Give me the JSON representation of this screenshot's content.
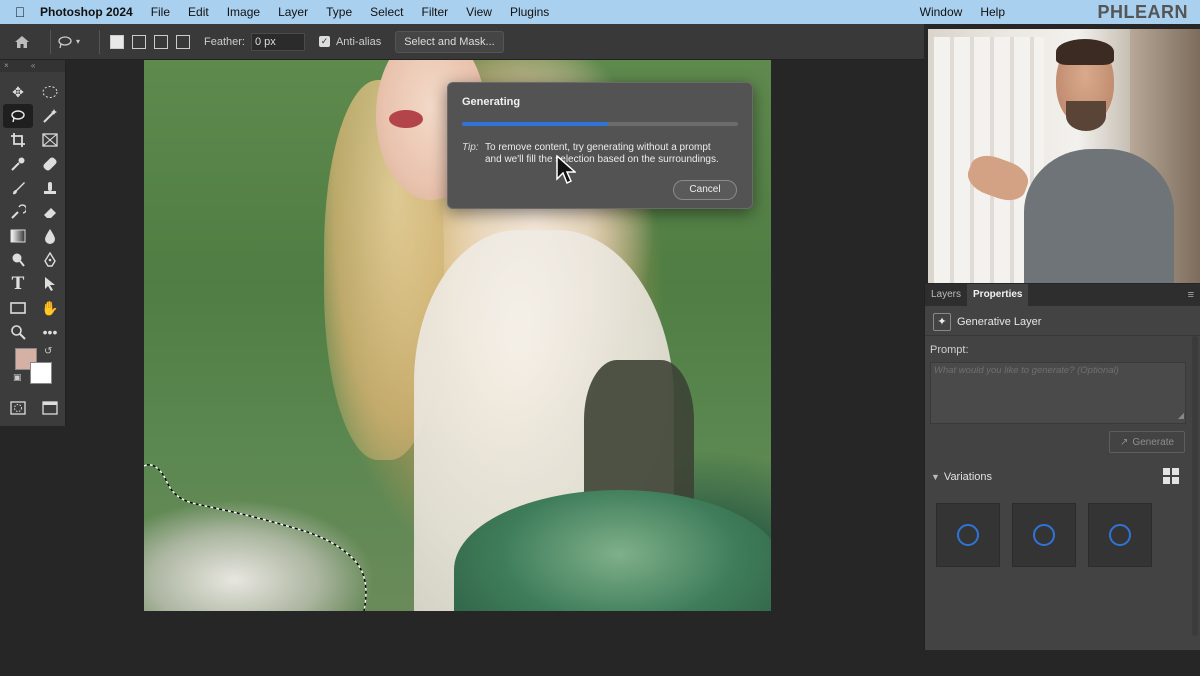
{
  "menubar": {
    "app_name": "Photoshop 2024",
    "items": [
      "File",
      "Edit",
      "Image",
      "Layer",
      "Type",
      "Select",
      "Filter",
      "View",
      "Plugins",
      "Window",
      "Help"
    ],
    "brand": "PHLEARN"
  },
  "options_bar": {
    "feather_label": "Feather:",
    "feather_value": "0 px",
    "anti_alias_label": "Anti-alias",
    "anti_alias_checked": true,
    "select_mask_label": "Select and Mask..."
  },
  "toolbar": {
    "foreground_color": "#d4b1a4",
    "background_color": "#ffffff",
    "tools": [
      "move-icon",
      "marquee-icon",
      "lasso-icon",
      "magic-wand-icon",
      "crop-icon",
      "frame-icon",
      "eyedropper-icon",
      "healing-icon",
      "brush-icon",
      "stamp-icon",
      "history-brush-icon",
      "eraser-icon",
      "gradient-icon",
      "blur-icon",
      "dodge-icon",
      "pen-icon",
      "type-icon",
      "path-select-icon",
      "rectangle-icon",
      "hand-icon",
      "zoom-icon",
      "more-icon"
    ],
    "active_tool": "lasso-icon"
  },
  "dialog": {
    "title": "Generating",
    "progress": 0.53,
    "tip_label": "Tip:",
    "tip_text": "To remove content, try generating without a prompt and we'll fill the selection based on the surroundings.",
    "cancel_label": "Cancel"
  },
  "panel": {
    "tabs": [
      "Layers",
      "Properties"
    ],
    "active_tab": "Properties",
    "layer_type": "Generative Layer",
    "prompt_label": "Prompt:",
    "prompt_placeholder": "What would you like to generate? (Optional)",
    "generate_label": "Generate",
    "variations_label": "Variations",
    "variation_count": 3
  },
  "colors": {
    "accent": "#2f74d8",
    "menubar": "#a9d0ef"
  }
}
